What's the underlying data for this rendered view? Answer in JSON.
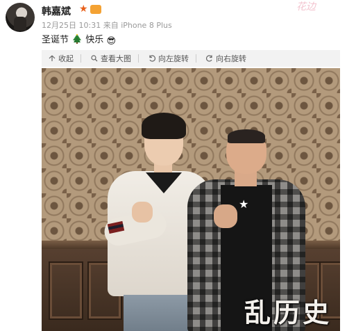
{
  "post": {
    "username": "韩嘉斌",
    "separator": "·",
    "level_badge": "VIP",
    "timestamp": "12月25日 10:31",
    "source": "来自 iPhone 8 Plus",
    "status_prefix": "圣诞节",
    "status_suffix": "快乐",
    "emoji_sunglasses": "😎"
  },
  "toolbar": {
    "collapse": "收起",
    "view_large": "查看大图",
    "rotate_left": "向左旋转",
    "rotate_right": "向右旋转"
  },
  "watermarks": {
    "top_right": "花边",
    "bottom": "乱历史"
  },
  "colors": {
    "accent_orange": "#e8601a",
    "toolbar_bg": "#f2f2f2",
    "meta_text": "#999999"
  }
}
